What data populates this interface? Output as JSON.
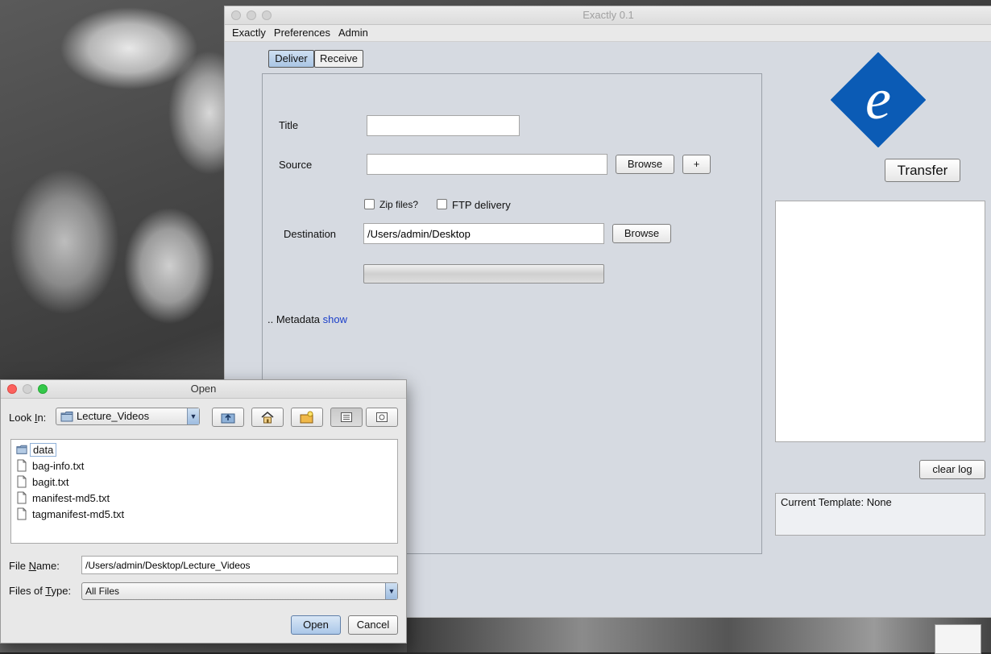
{
  "main_window": {
    "title": "Exactly 0.1",
    "menu": [
      "Exactly",
      "Preferences",
      "Admin"
    ],
    "tabs": [
      {
        "label": "Deliver",
        "active": true
      },
      {
        "label": "Receive",
        "active": false
      }
    ],
    "form": {
      "title_label": "Title",
      "title_value": "",
      "source_label": "Source",
      "source_value": "",
      "browse_label": "Browse",
      "add_label": "+",
      "zip_label": "Zip files?",
      "zip_checked": false,
      "ftp_label": "FTP delivery",
      "ftp_checked": false,
      "destination_label": "Destination",
      "destination_value": "/Users/admin/Desktop",
      "destination_browse_label": "Browse",
      "progress": 0,
      "metadata_prefix": ".. Metadata",
      "metadata_link": "show"
    },
    "logo_letter": "e",
    "transfer_label": "Transfer",
    "clear_log_label": "clear log",
    "template_text": "Current Template: None",
    "colors": {
      "logo_blue": "#0b5bb5",
      "link": "#1a3ec9",
      "tab_active": "#b7cfe9"
    }
  },
  "open_dialog": {
    "title": "Open",
    "look_in_label_pre": "Look ",
    "look_in_label_key": "I",
    "look_in_label_post": "n:",
    "look_in_value": "Lecture_Videos",
    "toolbar_icons": [
      "up-folder-icon",
      "home-icon",
      "new-folder-icon",
      "list-view-icon",
      "details-view-icon"
    ],
    "files": [
      {
        "name": "data",
        "type": "folder",
        "selected": true
      },
      {
        "name": "bag-info.txt",
        "type": "file",
        "selected": false
      },
      {
        "name": "bagit.txt",
        "type": "file",
        "selected": false
      },
      {
        "name": "manifest-md5.txt",
        "type": "file",
        "selected": false
      },
      {
        "name": "tagmanifest-md5.txt",
        "type": "file",
        "selected": false
      }
    ],
    "file_name_label_pre": "File ",
    "file_name_label_key": "N",
    "file_name_label_post": "ame:",
    "file_name_value": "/Users/admin/Desktop/Lecture_Videos",
    "files_of_type_label_pre": "Files of ",
    "files_of_type_label_key": "T",
    "files_of_type_label_post": "ype:",
    "files_of_type_value": "All Files",
    "open_label": "Open",
    "cancel_label": "Cancel"
  }
}
